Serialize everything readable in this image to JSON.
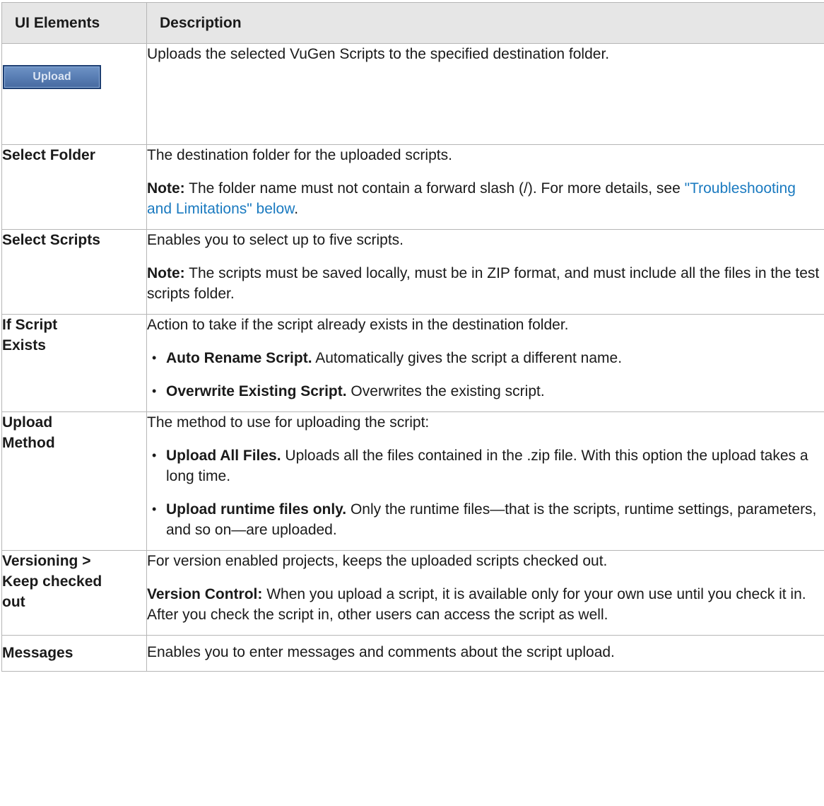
{
  "table": {
    "headers": [
      "UI Elements",
      "Description"
    ],
    "rows": {
      "upload": {
        "button_label": "Upload",
        "desc": "Uploads the selected VuGen Scripts to the specified destination folder."
      },
      "select_folder": {
        "label": "Select Folder",
        "desc": "The destination folder for the uploaded scripts.",
        "note_label": "Note:",
        "note_text": " The folder name must not contain a forward slash (/). For more details, see ",
        "note_link": "\"Troubleshooting and Limitations\" below",
        "note_end": "."
      },
      "select_scripts": {
        "label": "Select Scripts",
        "desc": "Enables you to select up to five scripts.",
        "note_label": "Note:",
        "note_text": " The scripts must be saved locally, must be in ZIP format, and must include all the files in the test scripts folder."
      },
      "if_script_exists": {
        "label_line1": "If Script",
        "label_line2": "Exists",
        "desc": "Action to take if the script already exists in the destination folder.",
        "options": [
          {
            "label": "Auto Rename Script.",
            "text": " Automatically gives the script a different name."
          },
          {
            "label": "Overwrite Existing Script.",
            "text": " Overwrites the existing script."
          }
        ]
      },
      "upload_method": {
        "label_line1": "Upload",
        "label_line2": "Method",
        "desc": "The method to use for uploading the script:",
        "options": [
          {
            "label": "Upload All Files.",
            "text": " Uploads all the files contained in the .zip file. With this option the upload takes a long time."
          },
          {
            "label": "Upload runtime files only.",
            "text": " Only the runtime files—that is the scripts, runtime settings, parameters, and so on—are uploaded."
          }
        ]
      },
      "versioning": {
        "label_line1": "Versioning >",
        "label_line2": "Keep checked",
        "label_line3": "out",
        "desc": "For version enabled projects, keeps the uploaded scripts checked out.",
        "note_label": "Version Control:",
        "note_text": " When you upload a script, it is available only for your own use until you check it in. After you check the script in, other users can access the script as well."
      },
      "messages": {
        "label": "Messages",
        "desc": "Enables you to enter messages and comments about the script upload."
      }
    }
  }
}
